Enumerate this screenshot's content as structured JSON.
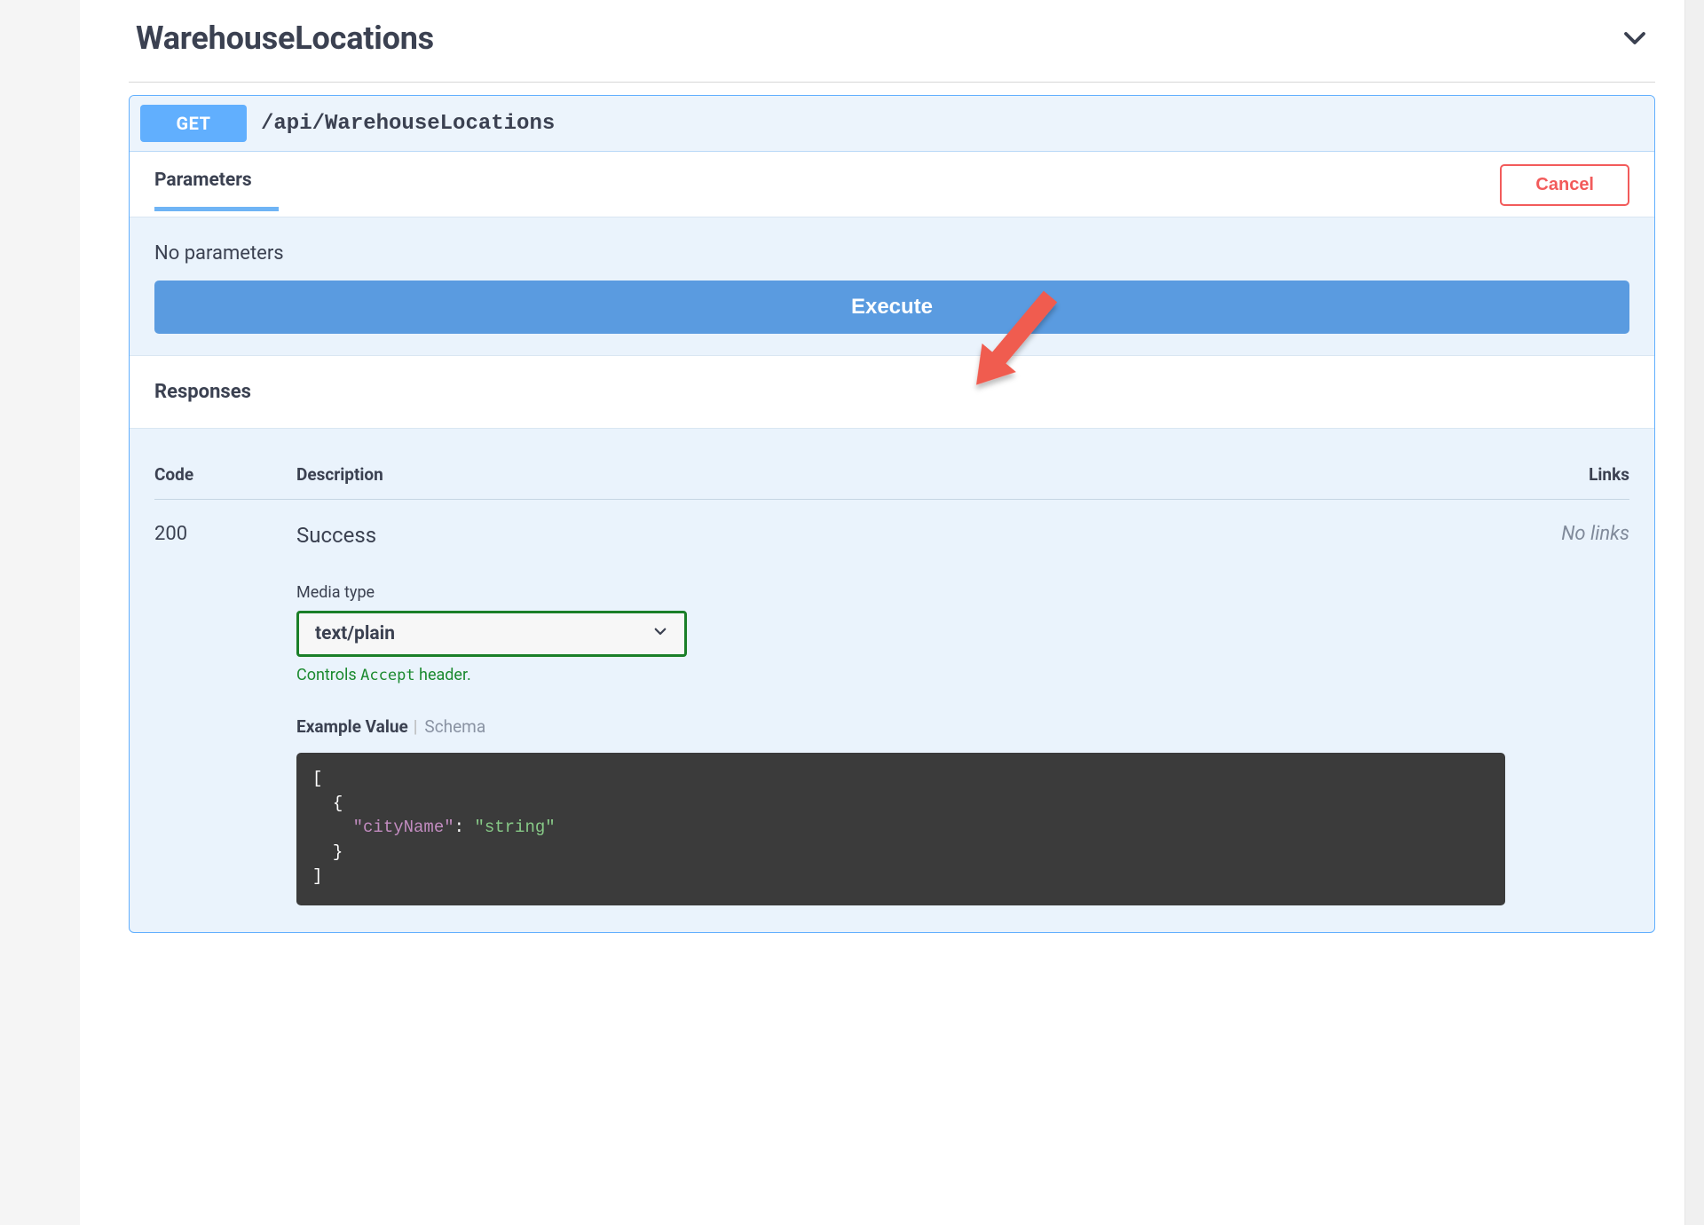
{
  "section": {
    "title": "WarehouseLocations"
  },
  "operation": {
    "method": "GET",
    "path": "/api/WarehouseLocations"
  },
  "parameters": {
    "tab_label": "Parameters",
    "cancel_label": "Cancel",
    "empty_text": "No parameters"
  },
  "execute": {
    "label": "Execute"
  },
  "responses": {
    "header": "Responses",
    "columns": {
      "code": "Code",
      "description": "Description",
      "links": "Links"
    },
    "rows": [
      {
        "code": "200",
        "description": "Success",
        "links": "No links",
        "media_type_label": "Media type",
        "media_type_value": "text/plain",
        "accept_hint_prefix": "Controls ",
        "accept_hint_code": "Accept",
        "accept_hint_suffix": " header.",
        "example_label": "Example Value",
        "schema_label": "Schema",
        "example_body": "[\n  {\n    \"cityName\": \"string\"\n  }\n]"
      }
    ]
  },
  "colors": {
    "method_get": "#61affe",
    "execute": "#4990e2",
    "cancel": "#f25b5b",
    "select_border": "#1a7f28",
    "arrow": "#f05b4f"
  }
}
